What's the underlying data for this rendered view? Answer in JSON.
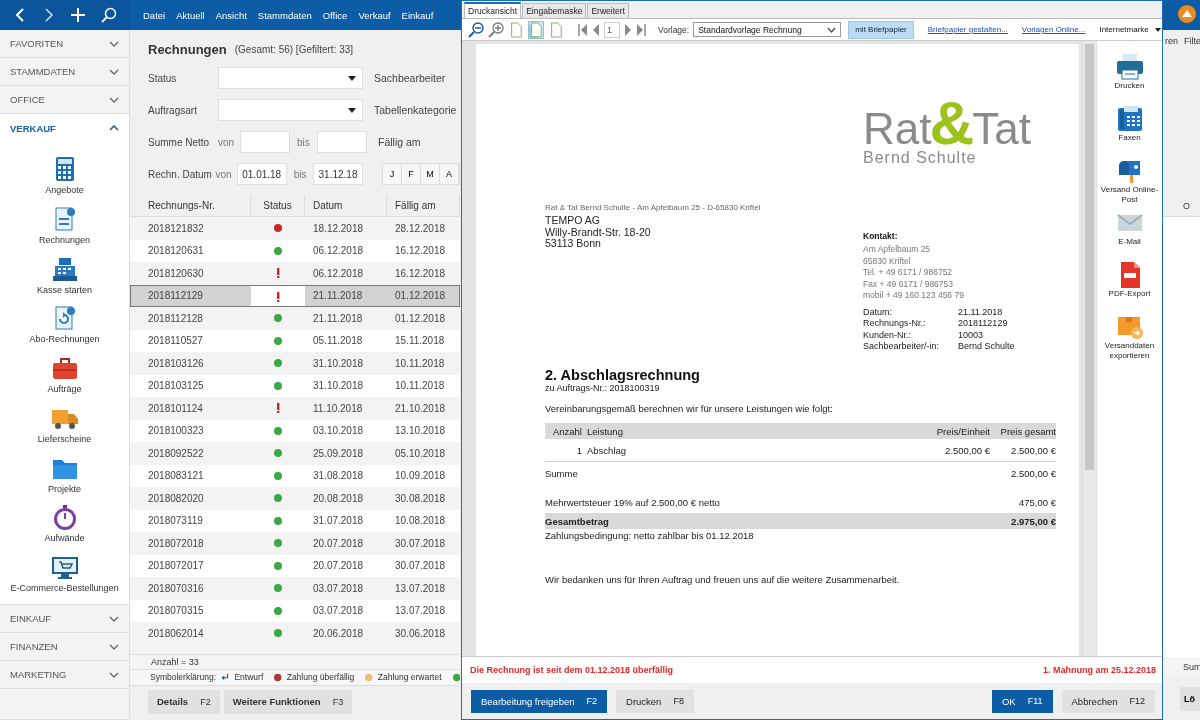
{
  "app": {
    "menu": [
      "Datei",
      "Aktuell",
      "Ansicht",
      "Stammdaten",
      "Office",
      "Verkauf",
      "Einkauf"
    ],
    "sidebar": [
      {
        "label": "FAVORITEN",
        "expanded": false
      },
      {
        "label": "STAMMDATEN",
        "expanded": false
      },
      {
        "label": "OFFICE",
        "expanded": false
      },
      {
        "label": "VERKAUF",
        "expanded": true,
        "items": [
          {
            "label": "Angebote",
            "kind": "calculator"
          },
          {
            "label": "Rechnungen",
            "kind": "invoice"
          },
          {
            "label": "Kasse starten",
            "kind": "register"
          },
          {
            "label": "Abo-Rechnungen",
            "kind": "subscription"
          },
          {
            "label": "Aufträge",
            "kind": "briefcase"
          },
          {
            "label": "Lieferscheine",
            "kind": "truck"
          },
          {
            "label": "Projekte",
            "kind": "folder"
          },
          {
            "label": "Aufwände",
            "kind": "stopwatch"
          },
          {
            "label": "E-Commerce-Bestellungen",
            "kind": "shop"
          }
        ]
      },
      {
        "label": "EINKAUF",
        "expanded": false
      },
      {
        "label": "FINANZEN",
        "expanded": false
      },
      {
        "label": "MARKETING",
        "expanded": false
      }
    ],
    "title": "Rechnungen",
    "counts": "(Gesamt: 56) [Gefiltert: 33]",
    "filters": {
      "status_label": "Status",
      "type_label": "Auftragsart",
      "sum_label": "Summe Netto",
      "date_label": "Rechn. Datum",
      "sum_range": [
        "von",
        "bis"
      ],
      "date_range": [
        "von",
        "bis"
      ],
      "date_from": "01.01.18",
      "date_to": "31.12.18",
      "right_labels": [
        "Sachbearbeiter",
        "Tabellenkategorie",
        "Fällig am"
      ],
      "months": [
        "J",
        "F",
        "M",
        "A"
      ]
    },
    "table": {
      "columns": [
        "Rechnungs-Nr.",
        "Status",
        "Datum",
        "Fällig am"
      ],
      "rows": [
        {
          "number": "2018121832",
          "kind": "overdue",
          "date": "18.12.2018",
          "due": "28.12.2018",
          "selected": false
        },
        {
          "number": "2018120631",
          "kind": "paid",
          "date": "06.12.2018",
          "due": "16.12.2018",
          "selected": false
        },
        {
          "number": "2018120630",
          "kind": "warning",
          "date": "06.12.2018",
          "due": "16.12.2018",
          "selected": false
        },
        {
          "number": "2018112129",
          "kind": "warning",
          "date": "21.11.2018",
          "due": "01.12.2018",
          "selected": true
        },
        {
          "number": "2018112128",
          "kind": "paid",
          "date": "21.11.2018",
          "due": "01.12.2018",
          "selected": false
        },
        {
          "number": "2018110527",
          "kind": "paid",
          "date": "05.11.2018",
          "due": "15.11.2018",
          "selected": false
        },
        {
          "number": "2018103126",
          "kind": "paid",
          "date": "31.10.2018",
          "due": "10.11.2018",
          "selected": false
        },
        {
          "number": "2018103125",
          "kind": "paid",
          "date": "31.10.2018",
          "due": "10.11.2018",
          "selected": false
        },
        {
          "number": "2018101124",
          "kind": "warning",
          "date": "11.10.2018",
          "due": "21.10.2018",
          "selected": false
        },
        {
          "number": "2018100323",
          "kind": "paid",
          "date": "03.10.2018",
          "due": "13.10.2018",
          "selected": false
        },
        {
          "number": "2018092522",
          "kind": "paid",
          "date": "25.09.2018",
          "due": "05.10.2018",
          "selected": false
        },
        {
          "number": "2018083121",
          "kind": "paid",
          "date": "31.08.2018",
          "due": "10.09.2018",
          "selected": false
        },
        {
          "number": "2018082020",
          "kind": "paid",
          "date": "20.08.2018",
          "due": "30.08.2018",
          "selected": false
        },
        {
          "number": "2018073119",
          "kind": "paid",
          "date": "31.07.2018",
          "due": "10.08.2018",
          "selected": false
        },
        {
          "number": "2018072018",
          "kind": "paid",
          "date": "20.07.2018",
          "due": "30.07.2018",
          "selected": false
        },
        {
          "number": "2018072017",
          "kind": "paid",
          "date": "20.07.2018",
          "due": "30.07.2018",
          "selected": false
        },
        {
          "number": "2018070316",
          "kind": "paid",
          "date": "03.07.2018",
          "due": "13.07.2018",
          "selected": false
        },
        {
          "number": "2018070315",
          "kind": "paid",
          "date": "03.07.2018",
          "due": "13.07.2018",
          "selected": false
        },
        {
          "number": "2018062014",
          "kind": "paid",
          "date": "20.06.2018",
          "due": "30.06.2018",
          "selected": false
        }
      ],
      "count": "Anzahl = 33"
    },
    "legend": {
      "label": "Symbolerklärung:",
      "items": [
        {
          "kind": "draft",
          "label": "Entwurf"
        },
        {
          "kind": "dot",
          "label": "Zahlung überfällig",
          "color": "#a83a3a"
        },
        {
          "kind": "dot",
          "label": "Zahlung erwartet",
          "color": "#e8c07a"
        },
        {
          "kind": "dot",
          "color": "#3aa845"
        }
      ]
    },
    "buttons": [
      {
        "label": "Details",
        "key": "F2"
      },
      {
        "label": "Weitere Funktionen",
        "key": "F3"
      }
    ],
    "right_edge": {
      "top_texts": [
        "ren",
        "Filte"
      ],
      "column_header": "O",
      "footer_text": "Sum",
      "button": "Lö"
    }
  },
  "dialog": {
    "tabs": [
      {
        "label": "Druckansicht",
        "selected": true
      },
      {
        "label": "Eingabemaske",
        "selected": false
      },
      {
        "label": "Erweitert",
        "selected": false
      }
    ],
    "views": [
      {
        "selected": false
      },
      {
        "selected": true
      },
      {
        "selected": false
      }
    ],
    "page": "1",
    "template_label": "Vorlage:",
    "template": "Standardvorlage Rechnung",
    "letterhead": {
      "label": "mit Briefpapier",
      "on": true
    },
    "links": [
      "Briefpapier gestalten...",
      "Vorlagen Online..."
    ],
    "menu": "Internetmarke",
    "document": {
      "logo": {
        "left": "Rat",
        "mid": "&",
        "right": "Tat",
        "sub": "Bernd Schulte"
      },
      "sender": "Rat & Tat Bernd Schulte - Am Apfelbaum 25 - D-65830 Kriftel",
      "recipient": [
        "TEMPO AG",
        "Willy-Brandt-Str. 18-20",
        "53113 Bonn"
      ],
      "contact_heading": "Kontakt:",
      "contact": [
        "Am Apfelbaum 25",
        "65830 Kriftel",
        "Tel. + 49 6171 / 986752",
        "Fax + 49 6171 / 986753",
        "mobil + 49 160 123 456 79"
      ],
      "info": [
        {
          "label": "Datum:",
          "value": "21.11.2018"
        },
        {
          "label": "Rechnungs-Nr.:",
          "value": "2018112129"
        },
        {
          "label": "Kunden-Nr.:",
          "value": "10003"
        },
        {
          "label": "Sachbearbeiter/-in:",
          "value": "Bernd Schulte"
        }
      ],
      "title": "2. Abschlagsrechnung",
      "subtitle": "zu Auftrags-Nr.: 2018100319",
      "intro": "Vereinbarungsgemäß berechnen wir für unsere Leistungen wie folgt:",
      "columns": [
        "Anzahl",
        "Leistung",
        "Preis/Einheit",
        "Preis gesamt"
      ],
      "items": [
        [
          "1",
          "Abschlag",
          "2.500,00 €",
          "2.500,00 €"
        ]
      ],
      "sum": {
        "label": "Summe",
        "value": "2.500,00 €"
      },
      "tax": {
        "label": "Mehrwertsteuer 19% auf 2.500,00 € netto",
        "value": "475,00 €"
      },
      "total": {
        "label": "Gesamtbetrag",
        "value": "2.975,00 €"
      },
      "terms": "Zahlungsbedingung: netto zahlbar bis 01.12.2018",
      "closing": "Wir bedanken uns für Ihren Auftrag und freuen uns auf die weitere Zusammenarbeit."
    },
    "actions": [
      {
        "kind": "printer",
        "label": "Drucken"
      },
      {
        "kind": "fax",
        "label": "Faxen"
      },
      {
        "kind": "mailbox",
        "label": "Versand Online-Post"
      },
      {
        "kind": "envelope",
        "label": "E-Mail"
      },
      {
        "kind": "pdf",
        "label": "PDF-Export"
      },
      {
        "kind": "parcel",
        "label": "Versanddaten exportieren"
      }
    ],
    "status_left": "Die Rechnung ist seit dem 01.12.2018 überfällig",
    "status_right": "1. Mahnung am 25.12.2018",
    "buttons_left": [
      {
        "label": "Bearbeitung freigeben",
        "key": "F2",
        "primary": true
      },
      {
        "label": "Drucken",
        "key": "F8",
        "primary": false
      }
    ],
    "buttons_right": [
      {
        "label": "OK",
        "key": "F11",
        "primary": true
      },
      {
        "label": "Abbrechen",
        "key": "F12",
        "primary": false
      }
    ]
  }
}
